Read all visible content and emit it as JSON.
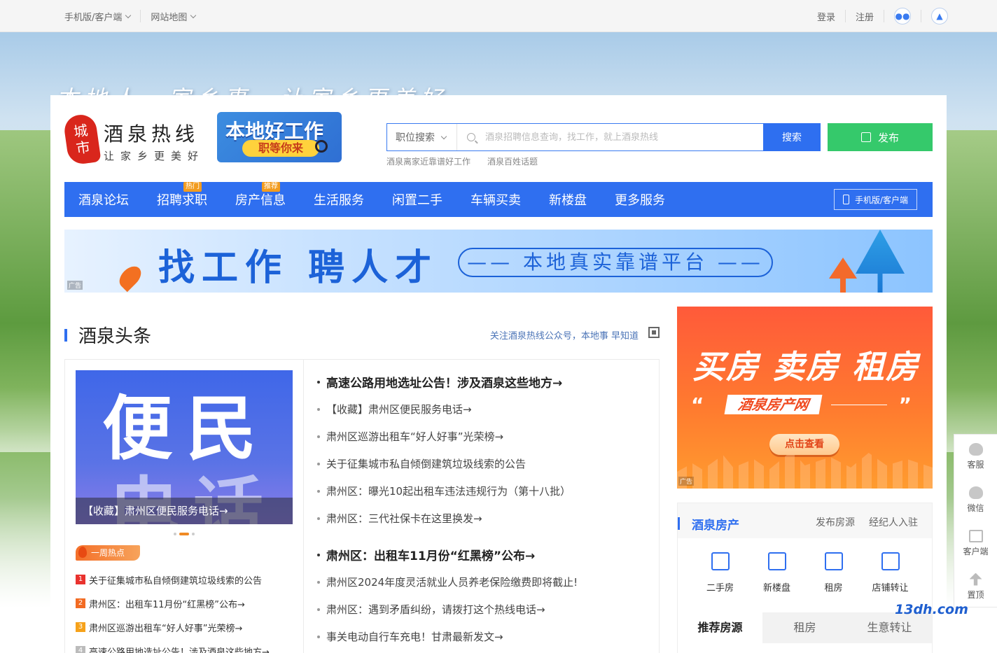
{
  "topbar": {
    "mobile_client": "手机版/客户端",
    "sitemap": "网站地图",
    "login": "登录",
    "register": "注册"
  },
  "slogan": "本地人，家乡事，让家乡更美好",
  "logo": {
    "badge_top": "城",
    "badge_bottom": "市",
    "title": "酒泉热线",
    "subtitle": "让家乡更美好"
  },
  "job_ad": {
    "title": "本地好工作",
    "subtitle": "职等你来"
  },
  "search": {
    "select_value": "职位搜索",
    "placeholder": "酒泉招聘信息查询，找工作，就上酒泉热线",
    "button": "搜索",
    "hotwords": [
      "酒泉离家近靠谱好工作",
      "酒泉百姓话题"
    ]
  },
  "publish": "发布",
  "nav": {
    "items": [
      {
        "label": "酒泉论坛",
        "badge": ""
      },
      {
        "label": "招聘求职",
        "badge": "热门"
      },
      {
        "label": "房产信息",
        "badge": "推荐"
      },
      {
        "label": "生活服务",
        "badge": ""
      },
      {
        "label": "闲置二手",
        "badge": ""
      },
      {
        "label": "车辆买卖",
        "badge": ""
      },
      {
        "label": "新楼盘",
        "badge": ""
      },
      {
        "label": "更多服务",
        "badge": ""
      }
    ],
    "mobile": "手机版/客户端"
  },
  "banner": {
    "headline": "找工作 聘人才",
    "pill": "—— 本地真实靠谱平台 ——",
    "ad_tag": "广告"
  },
  "news": {
    "title": "酒泉头条",
    "follow": "关注酒泉热线公众号，本地事 早知道",
    "slide": {
      "big1": "便民",
      "big2": "电话",
      "caption": "【收藏】肃州区便民服务电话→"
    },
    "hot_week": "一周热点",
    "hot_list": [
      {
        "n": "1",
        "text": "关于征集城市私自倾倒建筑垃圾线索的公告"
      },
      {
        "n": "2",
        "text": "肃州区：出租车11月份“红黑榜”公布→"
      },
      {
        "n": "3",
        "text": "肃州区巡游出租车“好人好事”光荣榜→"
      },
      {
        "n": "4",
        "text": "高速公路用地选址公告！涉及酒泉这些地方→"
      }
    ],
    "list": [
      "高速公路用地选址公告！涉及酒泉这些地方→",
      "【收藏】肃州区便民服务电话→",
      "肃州区巡游出租车“好人好事”光荣榜→",
      "关于征集城市私自倾倒建筑垃圾线索的公告",
      "肃州区：曝光10起出租车违法违规行为（第十八批）",
      "肃州区：三代社保卡在这里换发→",
      "肃州区：出租车11月份“红黑榜”公布→",
      "肃州区2024年度灵活就业人员养老保险缴费即将截止!",
      "肃州区：遇到矛盾纠纷，请拨打这个热线电话→",
      "事关电动自行车充电！甘肃最新发文→"
    ]
  },
  "house_ad": {
    "headline": "买房 卖房 租房",
    "brand": "酒泉房产网",
    "button": "点击查看",
    "ad_tag": "广告"
  },
  "house": {
    "title": "酒泉房产",
    "links": [
      "发布房源",
      "经纪人入驻"
    ],
    "cats": [
      "二手房",
      "新楼盘",
      "租房",
      "店铺转让"
    ],
    "tabs": [
      "推荐房源",
      "租房",
      "生意转让"
    ]
  },
  "sidebar": [
    "客服",
    "微信",
    "客户端",
    "置顶"
  ],
  "watermark": "13dh.com"
}
